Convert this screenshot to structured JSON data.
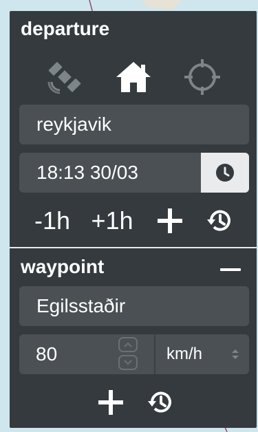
{
  "departure": {
    "title": "departure",
    "modes": [
      {
        "icon": "satellite-icon",
        "active": false
      },
      {
        "icon": "home-icon",
        "active": true
      },
      {
        "icon": "crosshair-icon",
        "active": false
      }
    ],
    "location": "reykjavik",
    "datetime": "18:13 30/03",
    "clock_icon": "clock-icon",
    "actions": {
      "minus_hour": "-1h",
      "plus_hour": "+1h",
      "add_icon": "plus-icon",
      "history_icon": "history-icon"
    }
  },
  "waypoint": {
    "title": "waypoint",
    "collapse_icon": "minus-icon",
    "location": "Egilsstaðir",
    "speed": "80",
    "unit": "km/h",
    "actions": {
      "add_icon": "plus-icon",
      "history_icon": "history-icon"
    }
  },
  "colors": {
    "panel": "#343a3d",
    "field": "#4a5053",
    "text": "#ffffff",
    "inactive_icon": "#7d8589",
    "map_water": "#cfe6ee"
  }
}
